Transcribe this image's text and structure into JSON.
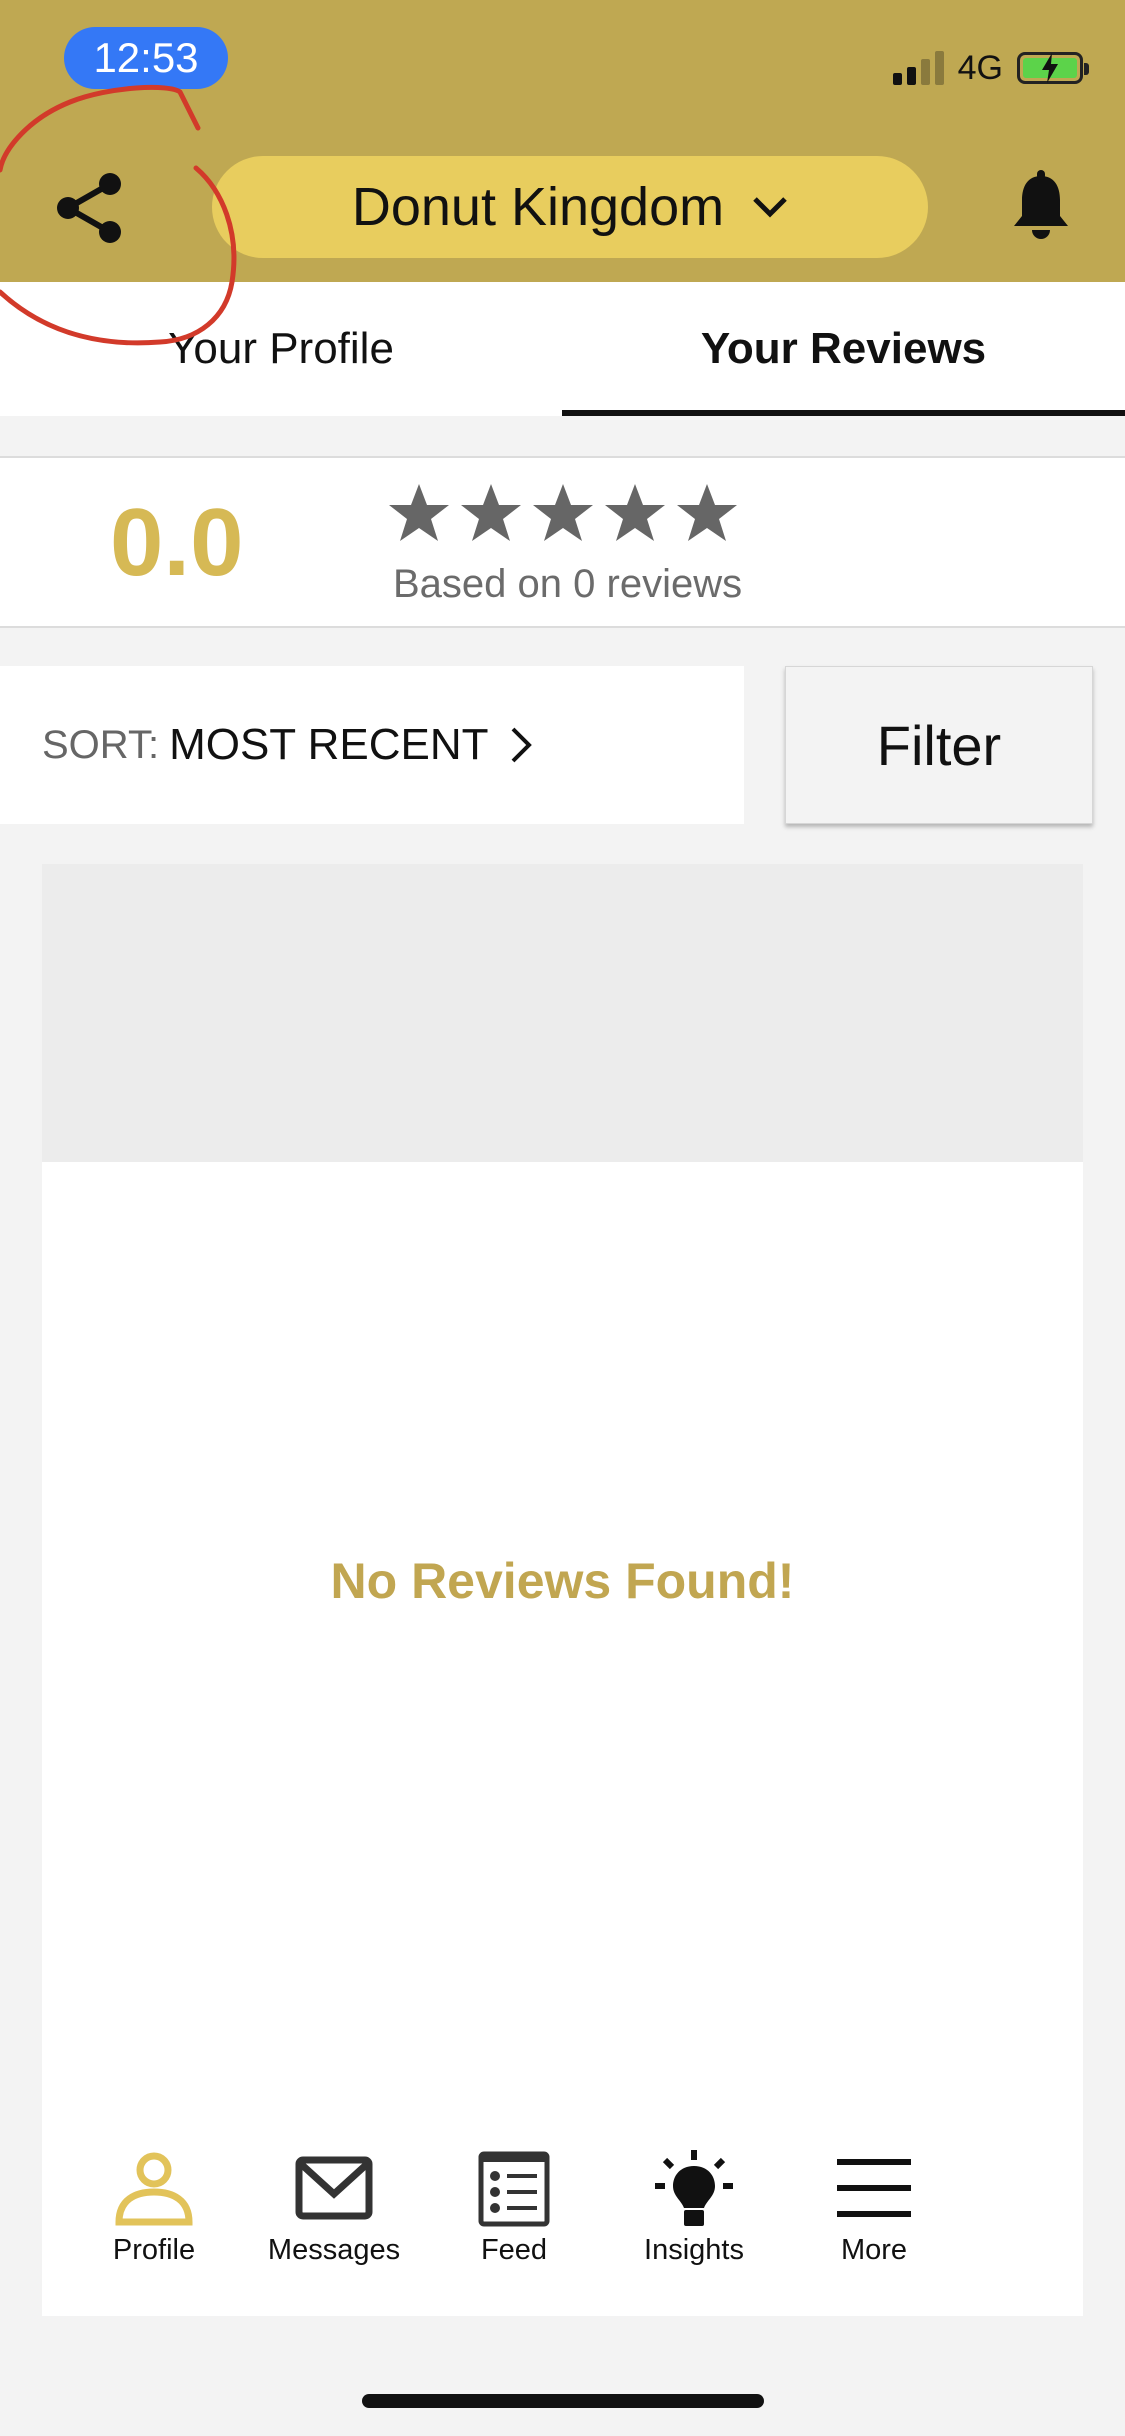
{
  "status_bar": {
    "time": "12:53",
    "network": "4G"
  },
  "header": {
    "business_name": "Donut Kingdom",
    "share_icon": "share-icon",
    "dropdown_icon": "chevron-down-icon",
    "bell_icon": "bell-icon"
  },
  "tabs": {
    "profile": "Your Profile",
    "reviews": "Your Reviews",
    "active": "reviews"
  },
  "rating": {
    "value": "0.0",
    "stars_filled": 0,
    "stars_total": 5,
    "based_on": "Based on 0 reviews"
  },
  "sort": {
    "label": "SORT:",
    "value": "MOST RECENT"
  },
  "filter": {
    "label": "Filter"
  },
  "empty_message": "No Reviews Found!",
  "nav": {
    "items": [
      {
        "label": "Profile",
        "icon": "profile-icon",
        "active": true
      },
      {
        "label": "Messages",
        "icon": "envelope-icon",
        "active": false
      },
      {
        "label": "Feed",
        "icon": "feed-icon",
        "active": false
      },
      {
        "label": "Insights",
        "icon": "lightbulb-icon",
        "active": false
      },
      {
        "label": "More",
        "icon": "menu-icon",
        "active": false
      }
    ]
  },
  "colors": {
    "header_bg": "#bfa852",
    "pill_bg": "#e8cd5e",
    "accent_gold": "#d6b955",
    "empty_text": "#c1a651",
    "time_pill": "#3478f6",
    "annotation_red": "#d23a2a"
  }
}
